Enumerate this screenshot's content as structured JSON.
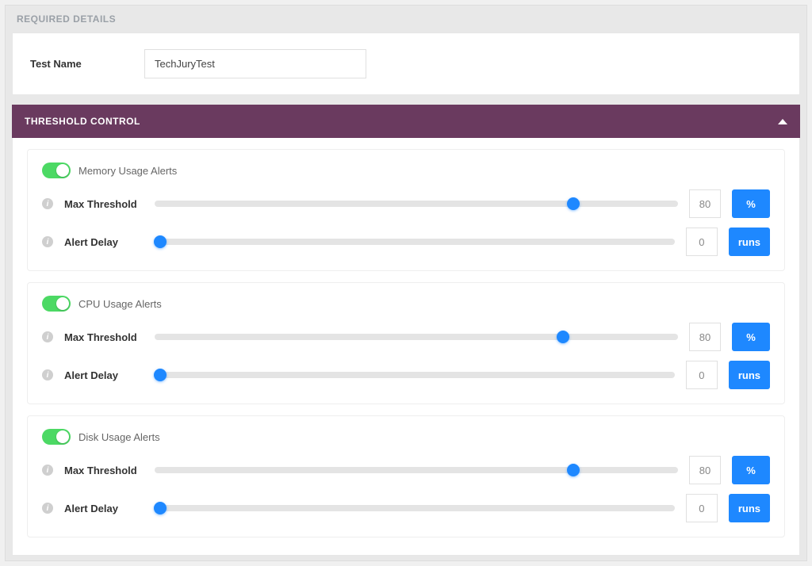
{
  "required": {
    "header": "REQUIRED DETAILS",
    "field_label": "Test Name",
    "field_value": "TechJuryTest"
  },
  "threshold": {
    "header": "THRESHOLD CONTROL",
    "labels": {
      "max_threshold": "Max Threshold",
      "alert_delay": "Alert Delay"
    },
    "units": {
      "percent": "%",
      "runs": "runs"
    },
    "cards": [
      {
        "title": "Memory Usage Alerts",
        "toggled": true,
        "max_threshold": {
          "value": "80",
          "pos": 80,
          "unit": "%"
        },
        "alert_delay": {
          "value": "0",
          "pos": 0,
          "unit": "runs"
        }
      },
      {
        "title": "CPU Usage Alerts",
        "toggled": true,
        "max_threshold": {
          "value": "80",
          "pos": 78,
          "unit": "%"
        },
        "alert_delay": {
          "value": "0",
          "pos": 0,
          "unit": "runs"
        }
      },
      {
        "title": "Disk Usage Alerts",
        "toggled": true,
        "max_threshold": {
          "value": "80",
          "pos": 80,
          "unit": "%"
        },
        "alert_delay": {
          "value": "0",
          "pos": 0,
          "unit": "runs"
        }
      }
    ]
  }
}
